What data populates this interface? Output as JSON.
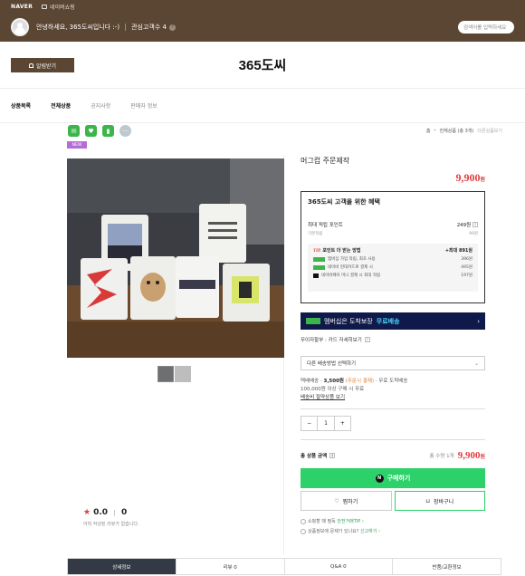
{
  "topbar": {
    "logo": "NAVER",
    "shop_label": "네이버쇼핑"
  },
  "greet": {
    "text": "안녕하세요, 365도씨입니다 :-)",
    "interest": "관심고객수 4",
    "search_placeholder": "검색어를 입력하세요"
  },
  "store": {
    "alarm_label": "알림받기",
    "title": "365도씨"
  },
  "menu": [
    "상품목록",
    "전체상품",
    "공지사항",
    "판매자 정보"
  ],
  "breadcrumb": {
    "home": "홈",
    "category": "전체상품 (총 3개)",
    "tail": "다른상품보기"
  },
  "badge_new": "NEW",
  "product": {
    "name": "머그컵 주문제작",
    "price": "9,900",
    "currency": "원"
  },
  "benefit": {
    "title": "365도씨 고객을 위한 혜택",
    "max_point_label": "최대 적립 포인트",
    "max_point": "249원",
    "basic_label": "기본적립",
    "basic_value": "99원",
    "tip_label": "TIP.",
    "tip_text": "포인트 더 받는 방법",
    "tip_max": "+최대 891원",
    "rows": [
      {
        "text": "멤버십 가입 적립, 최초 사용",
        "value": "396원"
      },
      {
        "text": "네이버 현대카드로 결제 시",
        "value": "495원"
      },
      {
        "text": "네이버페이 머니 결제 시 최대 적립",
        "value": "197원"
      }
    ]
  },
  "membership": {
    "text": "멤버십은 도착보장",
    "highlight": "무료배송",
    "chevron": "›"
  },
  "payment": {
    "text": "무이자할부 : 카드 자세히보기"
  },
  "shipping_select": "다른 배송방법 선택하기",
  "shipping": {
    "label": "택배배송",
    "fee": "3,500원",
    "cond": "(주문시 결제)",
    "region": "· 무료 도착배송",
    "free_line": "100,000원 이상 구매 시 무료",
    "link": "배송비 절약상품 보기"
  },
  "quantity": "1",
  "total": {
    "label": "총 상품 금액",
    "count": "총 수량 1개",
    "price": "9,900",
    "currency": "원"
  },
  "buttons": {
    "buy": "구매하기",
    "wish": "찜하기",
    "cart": "장바구니"
  },
  "notes": [
    {
      "text": "쇼핑할 때 필독 ",
      "link": "안전거래TIP ›"
    },
    {
      "text": "상품정보에 문제가 있나요? ",
      "link": "신고하기 ›"
    }
  ],
  "rating": {
    "score": "0.0",
    "reviews": "0",
    "note": "아직 작성된 리뷰가 없습니다."
  },
  "tabs": [
    "상세정보",
    "리뷰 0",
    "Q&A 0",
    "반품/교환정보"
  ],
  "colors": {
    "brand": "#5b4634",
    "price": "#e03c3c",
    "buy": "#2dd16a",
    "nav_banner": "#101a4a"
  }
}
